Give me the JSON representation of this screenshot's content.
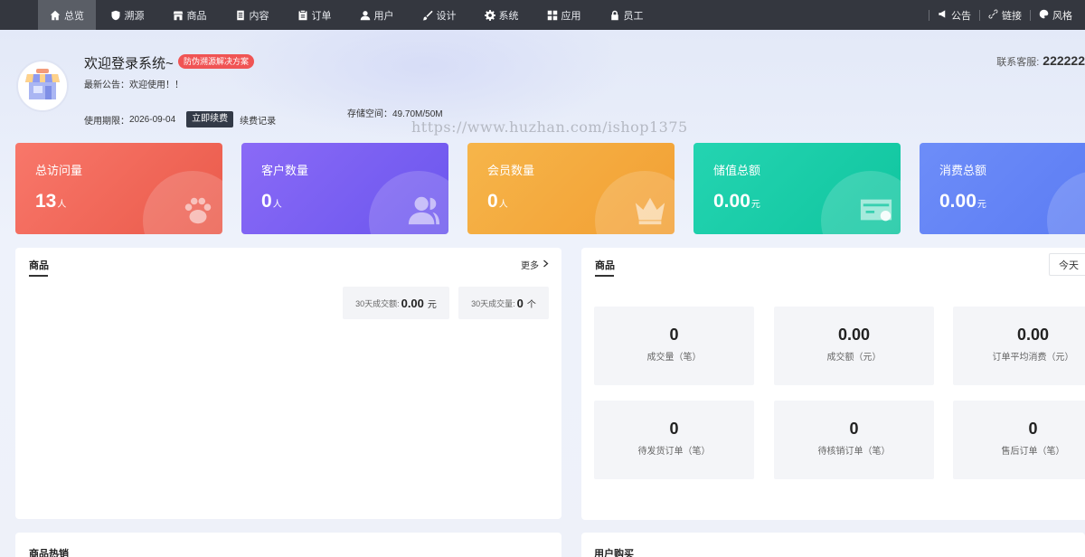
{
  "nav": {
    "items": [
      {
        "label": "总览",
        "icon": "home-icon"
      },
      {
        "label": "溯源",
        "icon": "shield-icon"
      },
      {
        "label": "商品",
        "icon": "shop-icon"
      },
      {
        "label": "内容",
        "icon": "document-icon"
      },
      {
        "label": "订单",
        "icon": "clipboard-icon"
      },
      {
        "label": "用户",
        "icon": "user-icon"
      },
      {
        "label": "设计",
        "icon": "brush-icon"
      },
      {
        "label": "系统",
        "icon": "gear-icon"
      },
      {
        "label": "应用",
        "icon": "grid-icon"
      },
      {
        "label": "员工",
        "icon": "lock-icon"
      }
    ],
    "active_index": 0,
    "tools": [
      {
        "label": "公告",
        "icon": "megaphone-icon"
      },
      {
        "label": "链接",
        "icon": "link-icon"
      },
      {
        "label": "风格",
        "icon": "palette-icon"
      }
    ]
  },
  "header": {
    "welcome": "欢迎登录系统~",
    "badge": "防伪溯源解决方案",
    "notice_label": "最新公告：",
    "notice_text": "欢迎使用！！",
    "expire_label": "使用期限：",
    "expire_date": "2026-09-04",
    "renew_button": "立即续费",
    "renew_log": "续费记录",
    "storage_label": "存储空间：",
    "storage_value": "49.70M/50M",
    "watermark": "https://www.huzhan.com/ishop1375",
    "contact_label": "联系客服:",
    "contact_value": "222222"
  },
  "stats": [
    {
      "title": "总访问量",
      "value": "13",
      "unit": "人",
      "color_from": "#f8776a",
      "color_to": "#ea5a4a",
      "icon": "paw-icon"
    },
    {
      "title": "客户数量",
      "value": "0",
      "unit": "人",
      "color_from": "#8a6af6",
      "color_to": "#6b56ee",
      "icon": "users-icon"
    },
    {
      "title": "会员数量",
      "value": "0",
      "unit": "人",
      "color_from": "#f6b54a",
      "color_to": "#f29f33",
      "icon": "crown-icon"
    },
    {
      "title": "储值总额",
      "value": "0.00",
      "unit": "元",
      "color_from": "#24d4b1",
      "color_to": "#10c59f",
      "icon": "card-icon"
    },
    {
      "title": "消费总额",
      "value": "0.00",
      "unit": "元",
      "color_from": "#6d8df8",
      "color_to": "#5a7af3",
      "icon": "coin-icon"
    }
  ],
  "goods_panel": {
    "title": "商品",
    "more": "更多",
    "kpi_amount_label": "30天成交额:",
    "kpi_amount_value": "0.00",
    "kpi_amount_unit": "元",
    "kpi_count_label": "30天成交量:",
    "kpi_count_value": "0",
    "kpi_count_unit": "个"
  },
  "order_panel": {
    "title": "商品",
    "today_button": "今天",
    "cells": [
      {
        "value": "0",
        "label": "成交量（笔）"
      },
      {
        "value": "0.00",
        "label": "成交额（元）"
      },
      {
        "value": "0.00",
        "label": "订单平均消费（元）"
      },
      {
        "value": "0",
        "label": "待发货订单（笔）"
      },
      {
        "value": "0",
        "label": "待核销订单（笔）"
      },
      {
        "value": "0",
        "label": "售后订单（笔）"
      }
    ]
  },
  "bottom": {
    "hot_title": "商品热销",
    "buy_title": "用户购买"
  }
}
